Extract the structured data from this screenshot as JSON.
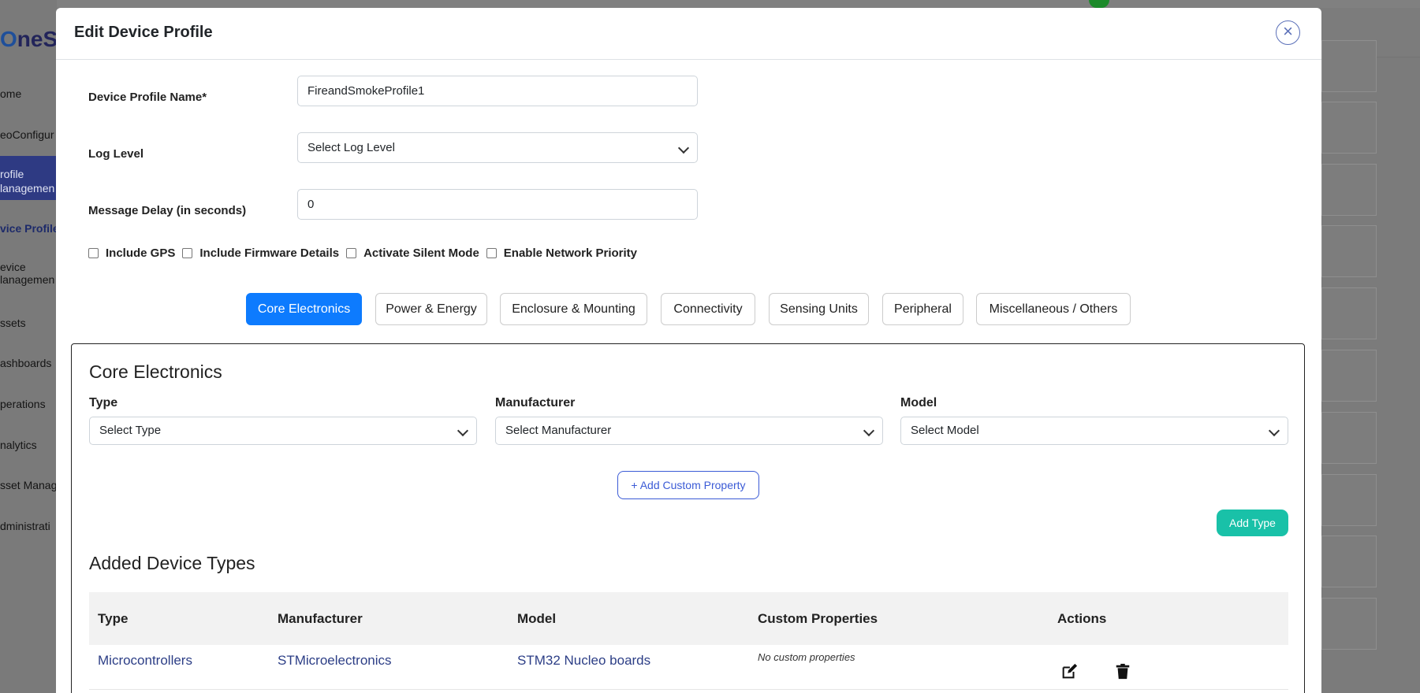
{
  "background": {
    "logo": "neS",
    "logo_o": "O",
    "nav": [
      {
        "label": "ome"
      },
      {
        "label": "eoConfigur"
      },
      {
        "label": "rofile",
        "label2": "lanagemen"
      },
      {
        "label": "vice Profiles"
      },
      {
        "label": "evice",
        "label2": "lanagemen"
      },
      {
        "label": "ssets"
      },
      {
        "label": "ashboards"
      },
      {
        "label": "perations"
      },
      {
        "label": "nalytics"
      },
      {
        "label": "sset Manag"
      },
      {
        "label": "dministrati"
      }
    ]
  },
  "modal": {
    "title": "Edit Device Profile",
    "close_icon": "close-icon",
    "form": {
      "name_label": "Device Profile Name*",
      "name_value": "FireandSmokeProfile1",
      "log_label": "Log Level",
      "log_value": "Select Log Level",
      "delay_label": "Message Delay (in seconds)",
      "delay_value": "0"
    },
    "checkboxes": [
      {
        "label": "Include GPS",
        "checked": false
      },
      {
        "label": "Include Firmware Details",
        "checked": false
      },
      {
        "label": "Activate Silent Mode",
        "checked": false
      },
      {
        "label": "Enable Network Priority",
        "checked": false
      }
    ],
    "tabs": [
      {
        "label": "Core Electronics",
        "active": true
      },
      {
        "label": "Power & Energy",
        "active": false
      },
      {
        "label": "Enclosure & Mounting",
        "active": false
      },
      {
        "label": "Connectivity",
        "active": false
      },
      {
        "label": "Sensing Units",
        "active": false
      },
      {
        "label": "Peripheral",
        "active": false
      },
      {
        "label": "Miscellaneous / Others",
        "active": false
      }
    ],
    "panel": {
      "title": "Core Electronics",
      "type_label": "Type",
      "type_value": "Select Type",
      "manufacturer_label": "Manufacturer",
      "manufacturer_value": "Select Manufacturer",
      "model_label": "Model",
      "model_value": "Select Model",
      "add_custom_label": "+ Add Custom Property",
      "add_type_label": "Add Type",
      "added_title": "Added Device Types",
      "table": {
        "headers": [
          "Type",
          "Manufacturer",
          "Model",
          "Custom Properties",
          "Actions"
        ],
        "rows": [
          {
            "type": "Microcontrollers",
            "manufacturer": "STMicroelectronics",
            "model": "STM32 Nucleo boards",
            "custom": "No custom properties"
          }
        ]
      }
    }
  },
  "colors": {
    "primary_tab": "#0d7bfe",
    "add_type": "#19c1a8",
    "link_blue": "#2c3e86"
  }
}
